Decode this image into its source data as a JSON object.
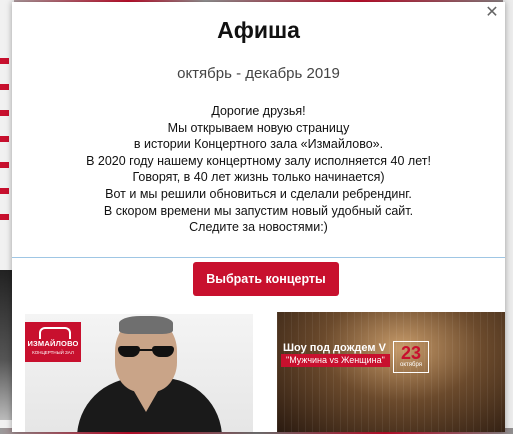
{
  "modal": {
    "title": "Афиша",
    "period": "октябрь - декабрь 2019",
    "message_lines": [
      "Дорогие друзья!",
      "Мы открываем новую страницу",
      "в истории Концертного зала «Измайлово».",
      "В 2020 году нашему концертному залу исполняется 40 лет!",
      "Говорят, в 40 лет жизнь только начинается)",
      "Вот и мы решили обновиться и сделали ребрендинг.",
      "В скором времени мы запустим новый удобный сайт.",
      "Следите за новостями:)"
    ],
    "button_label": "Выбрать концерты",
    "close_icon": "close-icon"
  },
  "cards": [
    {
      "logo_name": "ИЗМАЙЛОВО",
      "logo_sub": "КОНЦЕРТНЫЙ ЗАЛ"
    },
    {
      "show_title": "Шоу под дождем V",
      "show_sub": "\"Мужчина vs Женщина\"",
      "date_day": "23",
      "date_month": "октября"
    }
  ],
  "colors": {
    "accent": "#c8102e",
    "divider": "#9fc6e4"
  }
}
